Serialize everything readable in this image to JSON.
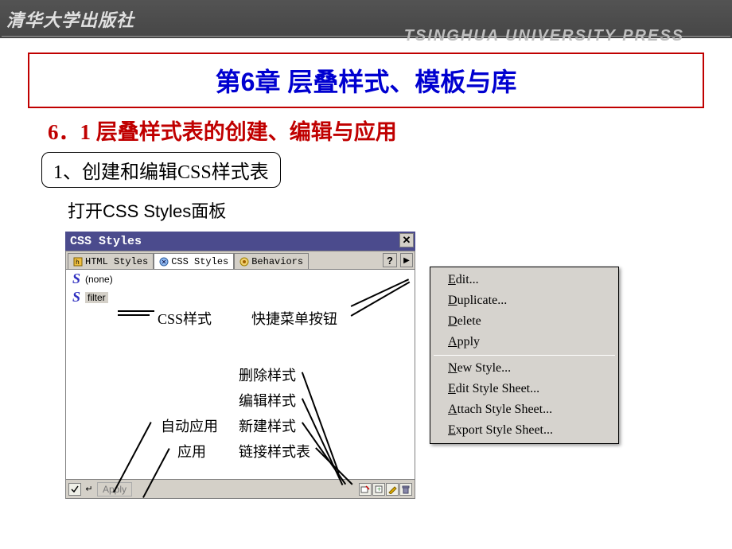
{
  "header": {
    "cn": "清华大学出版社",
    "en": "TSINGHUA UNIVERSITY PRESS"
  },
  "chapter_title": "第6章 层叠样式、模板与库",
  "section_title": "6．1 层叠样式表的创建、编辑与应用",
  "sub_item": "1、创建和编辑CSS样式表",
  "sub_text_prefix": "打开",
  "sub_text_mid": "CSS Styles",
  "sub_text_suffix": "面板",
  "panel": {
    "title": "CSS Styles",
    "tabs": [
      "HTML Styles",
      "CSS Styles",
      "Behaviors"
    ],
    "help": "?",
    "flyout": "▶",
    "close": "✕",
    "items": [
      {
        "label": "(none)",
        "selected": false
      },
      {
        "label": "filter",
        "selected": true
      }
    ],
    "footer_apply": "Apply"
  },
  "annotations": {
    "css_style": "CSS样式",
    "shortcut_btn": "快捷菜单按钮",
    "delete_style": "删除样式",
    "edit_style": "编辑样式",
    "auto_apply": "自动应用",
    "new_style": "新建样式",
    "apply": "应用",
    "link_sheet": "链接样式表"
  },
  "context_menu": {
    "group1": [
      {
        "u": "E",
        "rest": "dit..."
      },
      {
        "u": "D",
        "rest": "uplicate..."
      },
      {
        "u": "D",
        "rest": "elete"
      },
      {
        "u": "A",
        "rest": "pply"
      }
    ],
    "group2": [
      {
        "u": "N",
        "rest": "ew Style..."
      },
      {
        "u": "E",
        "rest": "dit Style Sheet..."
      },
      {
        "u": "A",
        "rest": "ttach Style Sheet..."
      },
      {
        "u": "E",
        "rest": "xport Style Sheet..."
      }
    ]
  }
}
